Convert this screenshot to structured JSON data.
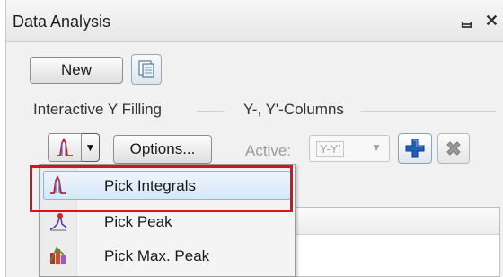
{
  "window": {
    "title": "Data Analysis",
    "float_icon": "float-window-icon",
    "close_icon": "close-icon",
    "float_glyph": "ᆸ",
    "close_glyph": "✕"
  },
  "toolbar": {
    "new_label": "New",
    "copy_icon": "copy-document-icon"
  },
  "interactive_y_filling": {
    "label": "Interactive Y Filling",
    "mode_icon": "integral-peak-icon",
    "options_label": "Options..."
  },
  "y_columns": {
    "label": "Y-, Y'-Columns",
    "active_label": "Active:",
    "active_value": "Y-Y'",
    "add_icon": "plus-icon",
    "remove_icon": "x-icon"
  },
  "dropdown_menu": {
    "items": [
      {
        "label": "Pick Integrals",
        "icon": "integral-peak-icon",
        "highlighted": true
      },
      {
        "label": "Pick Peak",
        "icon": "peak-pick-icon",
        "highlighted": false
      },
      {
        "label": "Pick Max. Peak",
        "icon": "max-peak-icon",
        "highlighted": false
      }
    ]
  },
  "colors": {
    "highlight_outline": "#d4161b",
    "menu_highlight": "#d7e7f7",
    "plus_blue": "#1f5fb8"
  }
}
